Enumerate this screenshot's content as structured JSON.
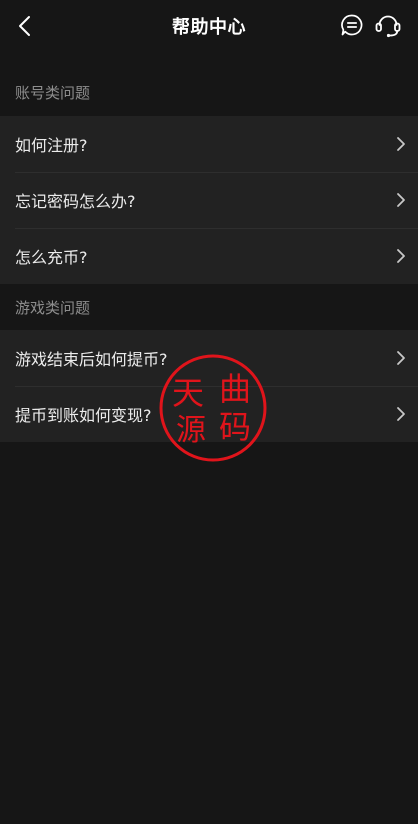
{
  "header": {
    "title": "帮助中心",
    "back_icon": "chevron-left-icon",
    "message_icon": "chat-bubble-icon",
    "service_icon": "headset-icon"
  },
  "sections": [
    {
      "title": "账号类问题",
      "items": [
        {
          "label": "如何注册?"
        },
        {
          "label": "忘记密码怎么办?"
        },
        {
          "label": "怎么充币?"
        }
      ]
    },
    {
      "title": "游戏类问题",
      "items": [
        {
          "label": "游戏结束后如何提币?"
        },
        {
          "label": "提币到账如何变现?"
        }
      ]
    }
  ],
  "watermark": {
    "text": "天曲源码",
    "color": "#e0141b"
  },
  "colors": {
    "background": "#161616",
    "list_background": "#222222",
    "section_title": "#8d8d8d",
    "item_text": "#ececec"
  }
}
